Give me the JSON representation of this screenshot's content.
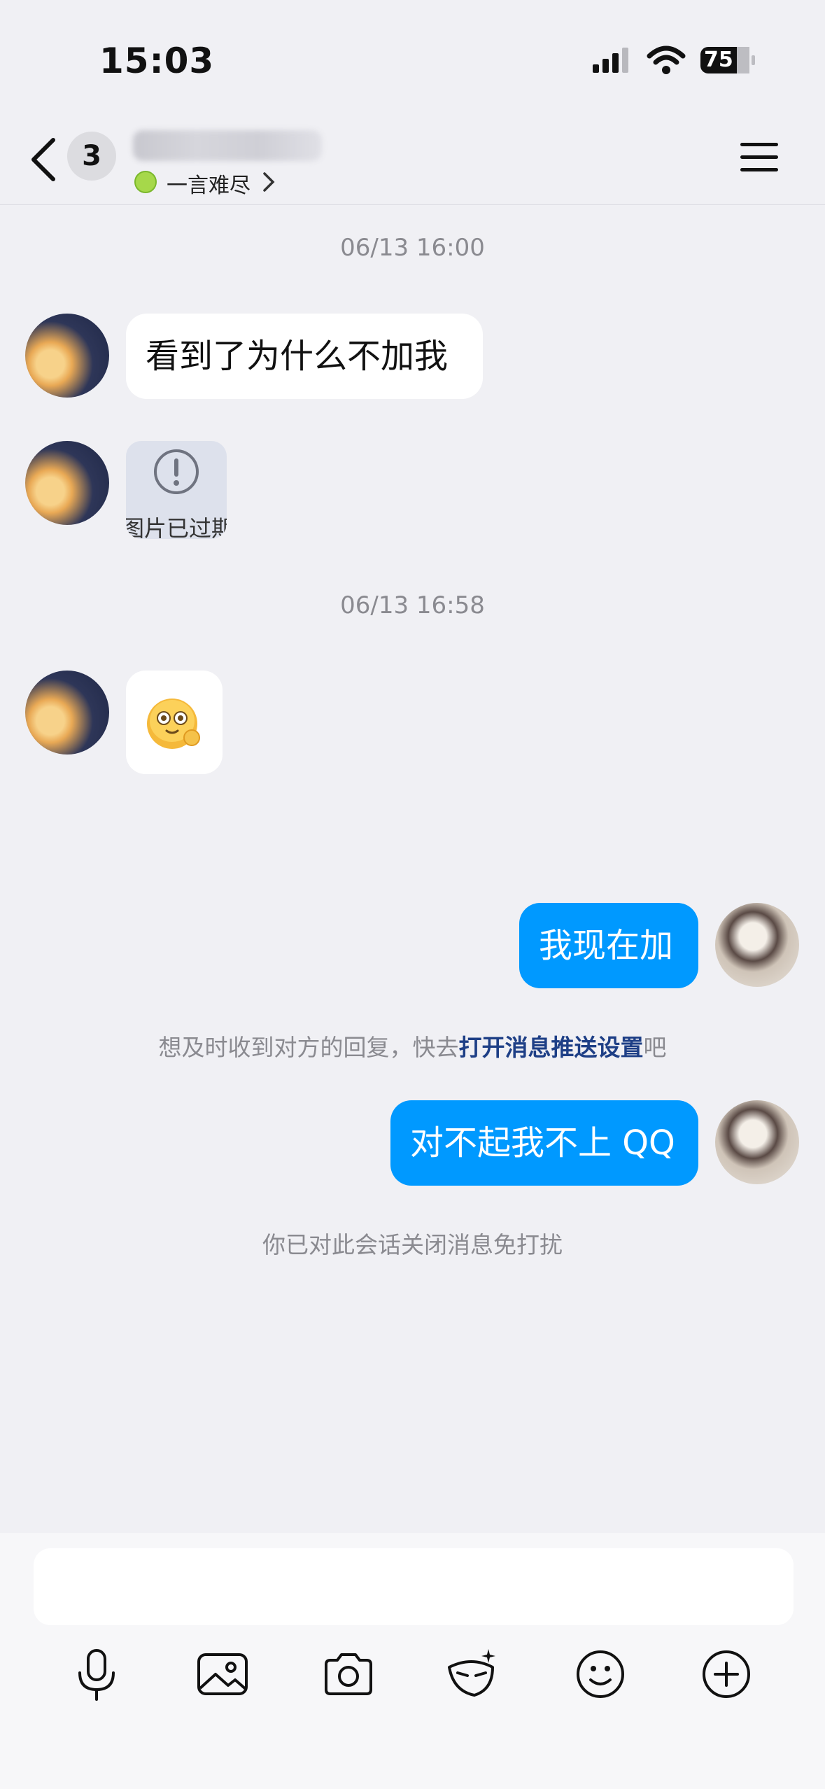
{
  "status_bar": {
    "time": "15:03",
    "battery": "75"
  },
  "header": {
    "unread_count": "3",
    "status_text": "一言难尽"
  },
  "messages": {
    "stamp1": "06/13 16:00",
    "msg1": "看到了为什么不加我",
    "expired_image": "图片已过期",
    "stamp2": "06/13 16:58",
    "msg_out1": "我现在加",
    "push_notice_prefix": "想及时收到对方的回复，快去",
    "push_notice_link": "打开消息推送设置",
    "push_notice_suffix": "吧",
    "msg_out2": "对不起我不上 QQ",
    "dnd_notice": "你已对此会话关闭消息免打扰"
  },
  "input": {
    "placeholder": ""
  },
  "colors": {
    "accent": "#0099ff",
    "link": "#1e3f86"
  },
  "toolbar_icons": [
    "microphone-icon",
    "image-icon",
    "camera-icon",
    "mask-icon",
    "emoji-icon",
    "plus-icon"
  ]
}
